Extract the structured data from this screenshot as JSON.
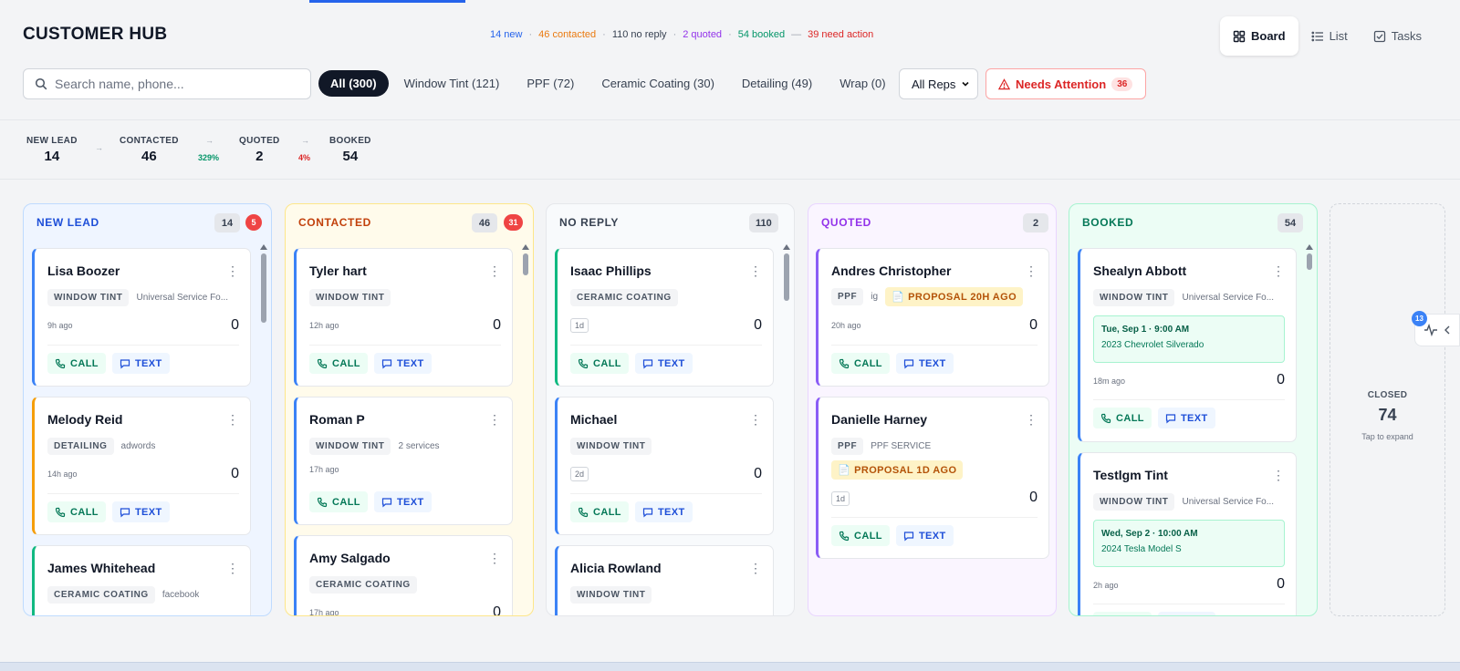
{
  "app": {
    "title": "CUSTOMER HUB"
  },
  "summary": {
    "new": "14 new",
    "contacted": "46 contacted",
    "no_reply": "110 no reply",
    "quoted": "2 quoted",
    "booked": "54 booked",
    "need_action": "39 need action",
    "dot": "·",
    "dash": "—"
  },
  "views": {
    "board": "Board",
    "list": "List",
    "tasks": "Tasks",
    "active": "board"
  },
  "search": {
    "placeholder": "Search name, phone...",
    "value": ""
  },
  "filters": [
    "All (300)",
    "Window Tint (121)",
    "PPF (72)",
    "Ceramic Coating (30)",
    "Detailing (49)",
    "Wrap (0)"
  ],
  "active_filter": "All (300)",
  "reps": {
    "selected": "All Reps"
  },
  "needs_attention": {
    "label": "Needs Attention",
    "count": "36"
  },
  "funnel": {
    "stages": [
      {
        "label": "NEW LEAD",
        "value": "14"
      },
      {
        "label": "CONTACTED",
        "value": "46"
      },
      {
        "label": "QUOTED",
        "value": "2"
      },
      {
        "label": "BOOKED",
        "value": "54"
      }
    ],
    "arrow": "→",
    "conv_contacted_quoted": "329%",
    "conv_quoted_booked": "4%"
  },
  "actions": {
    "call": "CALL",
    "text": "TEXT"
  },
  "columns": [
    {
      "title": "NEW LEAD",
      "count": "14",
      "alert": "5",
      "cards": [
        {
          "name": "Lisa Boozer",
          "tag": "WINDOW TINT",
          "source": "Universal Service Fo...",
          "ago": "9h ago",
          "score": "0"
        },
        {
          "name": "Melody Reid",
          "tag": "DETAILING",
          "source": "adwords",
          "ago": "14h ago",
          "score": "0"
        },
        {
          "name": "James Whitehead",
          "tag": "CERAMIC COATING",
          "source": "facebook"
        }
      ]
    },
    {
      "title": "CONTACTED",
      "count": "46",
      "alert": "31",
      "cards": [
        {
          "name": "Tyler hart",
          "tag": "WINDOW TINT",
          "ago": "12h ago",
          "score": "0"
        },
        {
          "name": "Roman P",
          "tag": "WINDOW TINT",
          "source": "2 services",
          "ago": "17h ago"
        },
        {
          "name": "Amy Salgado",
          "tag": "CERAMIC COATING",
          "ago": "17h ago",
          "score": "0"
        }
      ]
    },
    {
      "title": "NO REPLY",
      "count": "110",
      "cards": [
        {
          "name": "Isaac Phillips",
          "tag": "CERAMIC COATING",
          "age": "1d",
          "score": "0"
        },
        {
          "name": "Michael",
          "tag": "WINDOW TINT",
          "age": "2d",
          "score": "0"
        },
        {
          "name": "Alicia Rowland",
          "tag": "WINDOW TINT"
        }
      ]
    },
    {
      "title": "QUOTED",
      "count": "2",
      "cards": [
        {
          "name": "Andres Christopher",
          "tag": "PPF",
          "source": "ig",
          "proposal": "PROPOSAL 20H AGO",
          "ago": "20h ago",
          "score": "0"
        },
        {
          "name": "Danielle Harney",
          "tag": "PPF",
          "source": "PPF SERVICE",
          "proposal": "PROPOSAL 1D AGO",
          "age": "1d",
          "score": "0"
        }
      ]
    },
    {
      "title": "BOOKED",
      "count": "54",
      "cards": [
        {
          "name": "Shealyn Abbott",
          "tag": "WINDOW TINT",
          "source": "Universal Service Fo...",
          "appt_date": "Tue, Sep 1 · 9:00 AM",
          "appt_vehicle": "2023 Chevrolet Silverado",
          "ago": "18m ago",
          "score": "0"
        },
        {
          "name": "Testlgm Tint",
          "tag": "WINDOW TINT",
          "source": "Universal Service Fo...",
          "appt_date": "Wed, Sep 2 · 10:00 AM",
          "appt_vehicle": "2024 Tesla Model S",
          "ago": "2h ago",
          "score": "0"
        }
      ]
    }
  ],
  "closed": {
    "label": "CLOSED",
    "count": "74",
    "hint": "Tap to expand"
  },
  "activity": {
    "badge": "13"
  },
  "colors": {
    "new_lead": "#1d4ed8",
    "contacted": "#c2410c",
    "no_reply": "#374151",
    "quoted": "#9333ea",
    "booked": "#047857",
    "alert": "#ef4444"
  }
}
